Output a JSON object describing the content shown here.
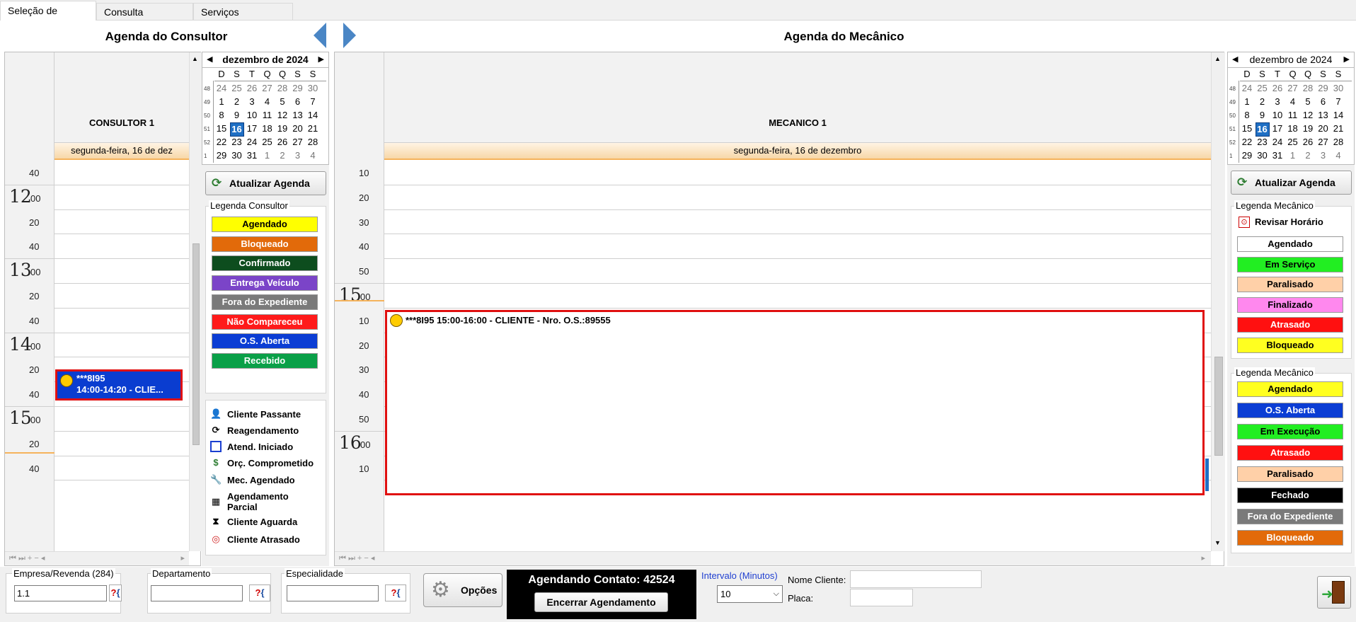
{
  "tabs": [
    "Seleção de Horários",
    "Consulta Avançada",
    "Serviços Agendados"
  ],
  "consultor": {
    "title": "Agenda do Consultor",
    "column": "CONSULTOR 1",
    "date": "segunda-feira, 16 de dez",
    "times": [
      {
        "hour": "",
        "min": "40"
      },
      {
        "hour": "12",
        "min": "00"
      },
      {
        "hour": "",
        "min": "20"
      },
      {
        "hour": "",
        "min": "40"
      },
      {
        "hour": "13",
        "min": "00"
      },
      {
        "hour": "",
        "min": "20"
      },
      {
        "hour": "",
        "min": "40"
      },
      {
        "hour": "14",
        "min": "00"
      },
      {
        "hour": "",
        "min": "20"
      },
      {
        "hour": "",
        "min": "40"
      },
      {
        "hour": "15",
        "min": "00"
      },
      {
        "hour": "",
        "min": "20"
      },
      {
        "hour": "",
        "min": "40"
      }
    ],
    "appointment": {
      "line1": "***8I95",
      "line2": "14:00-14:20 - CLIE...",
      "color": "#0a3dd0"
    },
    "update_button": "Atualizar Agenda",
    "legend_title": "Legenda Consultor",
    "legend": [
      {
        "label": "Agendado",
        "bg": "#ffff00",
        "fg": "#000000"
      },
      {
        "label": "Bloqueado",
        "bg": "#e26a0a",
        "fg": "#ffffff"
      },
      {
        "label": "Confirmado",
        "bg": "#0d4d1e",
        "fg": "#ffffff"
      },
      {
        "label": "Entrega Veículo",
        "bg": "#7b44c8",
        "fg": "#ffffff"
      },
      {
        "label": "Fora do Expediente",
        "bg": "#7a7a7a",
        "fg": "#ffffff"
      },
      {
        "label": "Não Compareceu",
        "bg": "#ff1a1a",
        "fg": "#ffffff"
      },
      {
        "label": "O.S. Aberta",
        "bg": "#0b3dd4",
        "fg": "#ffffff"
      },
      {
        "label": "Recebido",
        "bg": "#0aa048",
        "fg": "#ffffff"
      }
    ],
    "icon_legend": [
      {
        "icon": "person-icon",
        "glyph": "👤",
        "label": "Cliente Passante"
      },
      {
        "icon": "reschedule-icon",
        "glyph": "⟳",
        "label": "Reagendamento"
      },
      {
        "icon": "square-icon",
        "glyph": "☐",
        "label": "Atend. Iniciado"
      },
      {
        "icon": "dollar-icon",
        "glyph": "$",
        "label": "Orç. Comprometido"
      },
      {
        "icon": "mechanic-icon",
        "glyph": "🔧",
        "label": "Mec. Agendado"
      },
      {
        "icon": "partial-schedule-icon",
        "glyph": "▦",
        "label": "Agendamento Parcial"
      },
      {
        "icon": "hourglass-icon",
        "glyph": "⧗",
        "label": "Cliente Aguarda"
      },
      {
        "icon": "late-icon",
        "glyph": "◎",
        "label": "Cliente Atrasado"
      }
    ]
  },
  "mecanico": {
    "title": "Agenda do Mecânico",
    "column": "MECANICO 1",
    "date": "segunda-feira, 16 de dezembro",
    "times": [
      {
        "hour": "",
        "min": "10"
      },
      {
        "hour": "",
        "min": "20"
      },
      {
        "hour": "",
        "min": "30"
      },
      {
        "hour": "",
        "min": "40"
      },
      {
        "hour": "",
        "min": "50"
      },
      {
        "hour": "15",
        "min": "00"
      },
      {
        "hour": "",
        "min": "10"
      },
      {
        "hour": "",
        "min": "20"
      },
      {
        "hour": "",
        "min": "30"
      },
      {
        "hour": "",
        "min": "40"
      },
      {
        "hour": "",
        "min": "50"
      },
      {
        "hour": "16",
        "min": "00"
      },
      {
        "hour": "",
        "min": "10"
      }
    ],
    "appointment": {
      "text": "***8I95 15:00-16:00 - CLIENTE - Nro. O.S.:89555"
    },
    "update_button": "Atualizar Agenda",
    "legend1_title": "Legenda Mecânico",
    "revisar": "Revisar Horário",
    "legend1": [
      {
        "label": "Agendado",
        "bg": "#ffffff",
        "fg": "#000000"
      },
      {
        "label": "Em Serviço",
        "bg": "#22ee22",
        "fg": "#000000"
      },
      {
        "label": "Paralisado",
        "bg": "#ffd0a8",
        "fg": "#000000"
      },
      {
        "label": "Finalizado",
        "bg": "#ff88ee",
        "fg": "#000000"
      },
      {
        "label": "Atrasado",
        "bg": "#ff1010",
        "fg": "#ffffff"
      },
      {
        "label": "Bloqueado",
        "bg": "#ffff20",
        "fg": "#000000"
      }
    ],
    "legend2_title": "Legenda Mecânico",
    "legend2": [
      {
        "label": "Agendado",
        "bg": "#ffff20",
        "fg": "#000000"
      },
      {
        "label": "O.S. Aberta",
        "bg": "#0b3dd4",
        "fg": "#ffffff"
      },
      {
        "label": "Em Execução",
        "bg": "#22ee22",
        "fg": "#000000"
      },
      {
        "label": "Atrasado",
        "bg": "#ff1010",
        "fg": "#ffffff"
      },
      {
        "label": "Paralisado",
        "bg": "#ffd0a8",
        "fg": "#000000"
      },
      {
        "label": "Fechado",
        "bg": "#000000",
        "fg": "#ffffff"
      },
      {
        "label": "Fora do Expediente",
        "bg": "#7a7a7a",
        "fg": "#ffffff"
      },
      {
        "label": "Bloqueado",
        "bg": "#e26a0a",
        "fg": "#ffffff"
      }
    ]
  },
  "calendar": {
    "month": "dezembro de 2024",
    "weekdays": [
      "D",
      "S",
      "T",
      "Q",
      "Q",
      "S",
      "S"
    ],
    "weeks": [
      {
        "wk": "48",
        "days": [
          "24",
          "25",
          "26",
          "27",
          "28",
          "29",
          "30"
        ]
      },
      {
        "wk": "49",
        "days": [
          "1",
          "2",
          "3",
          "4",
          "5",
          "6",
          "7"
        ]
      },
      {
        "wk": "50",
        "days": [
          "8",
          "9",
          "10",
          "11",
          "12",
          "13",
          "14"
        ]
      },
      {
        "wk": "51",
        "days": [
          "15",
          "16",
          "17",
          "18",
          "19",
          "20",
          "21"
        ]
      },
      {
        "wk": "52",
        "days": [
          "22",
          "23",
          "24",
          "25",
          "26",
          "27",
          "28"
        ]
      },
      {
        "wk": "1",
        "days": [
          "29",
          "30",
          "31",
          "1",
          "2",
          "3",
          "4"
        ]
      }
    ],
    "selected": "16"
  },
  "bottom": {
    "empresa_label": "Empresa/Revenda (284)",
    "empresa_value": "1.1",
    "departamento_label": "Departamento",
    "departamento_value": "",
    "especialidade_label": "Especialidade",
    "especialidade_value": "",
    "opcoes": "Opções",
    "contato": "Agendando Contato: 42524",
    "encerrar": "Encerrar Agendamento",
    "intervalo_label": "Intervalo (Minutos)",
    "intervalo_value": "10",
    "nome_label": "Nome Cliente:",
    "nome_value": "",
    "placa_label": "Placa:",
    "placa_value": ""
  }
}
